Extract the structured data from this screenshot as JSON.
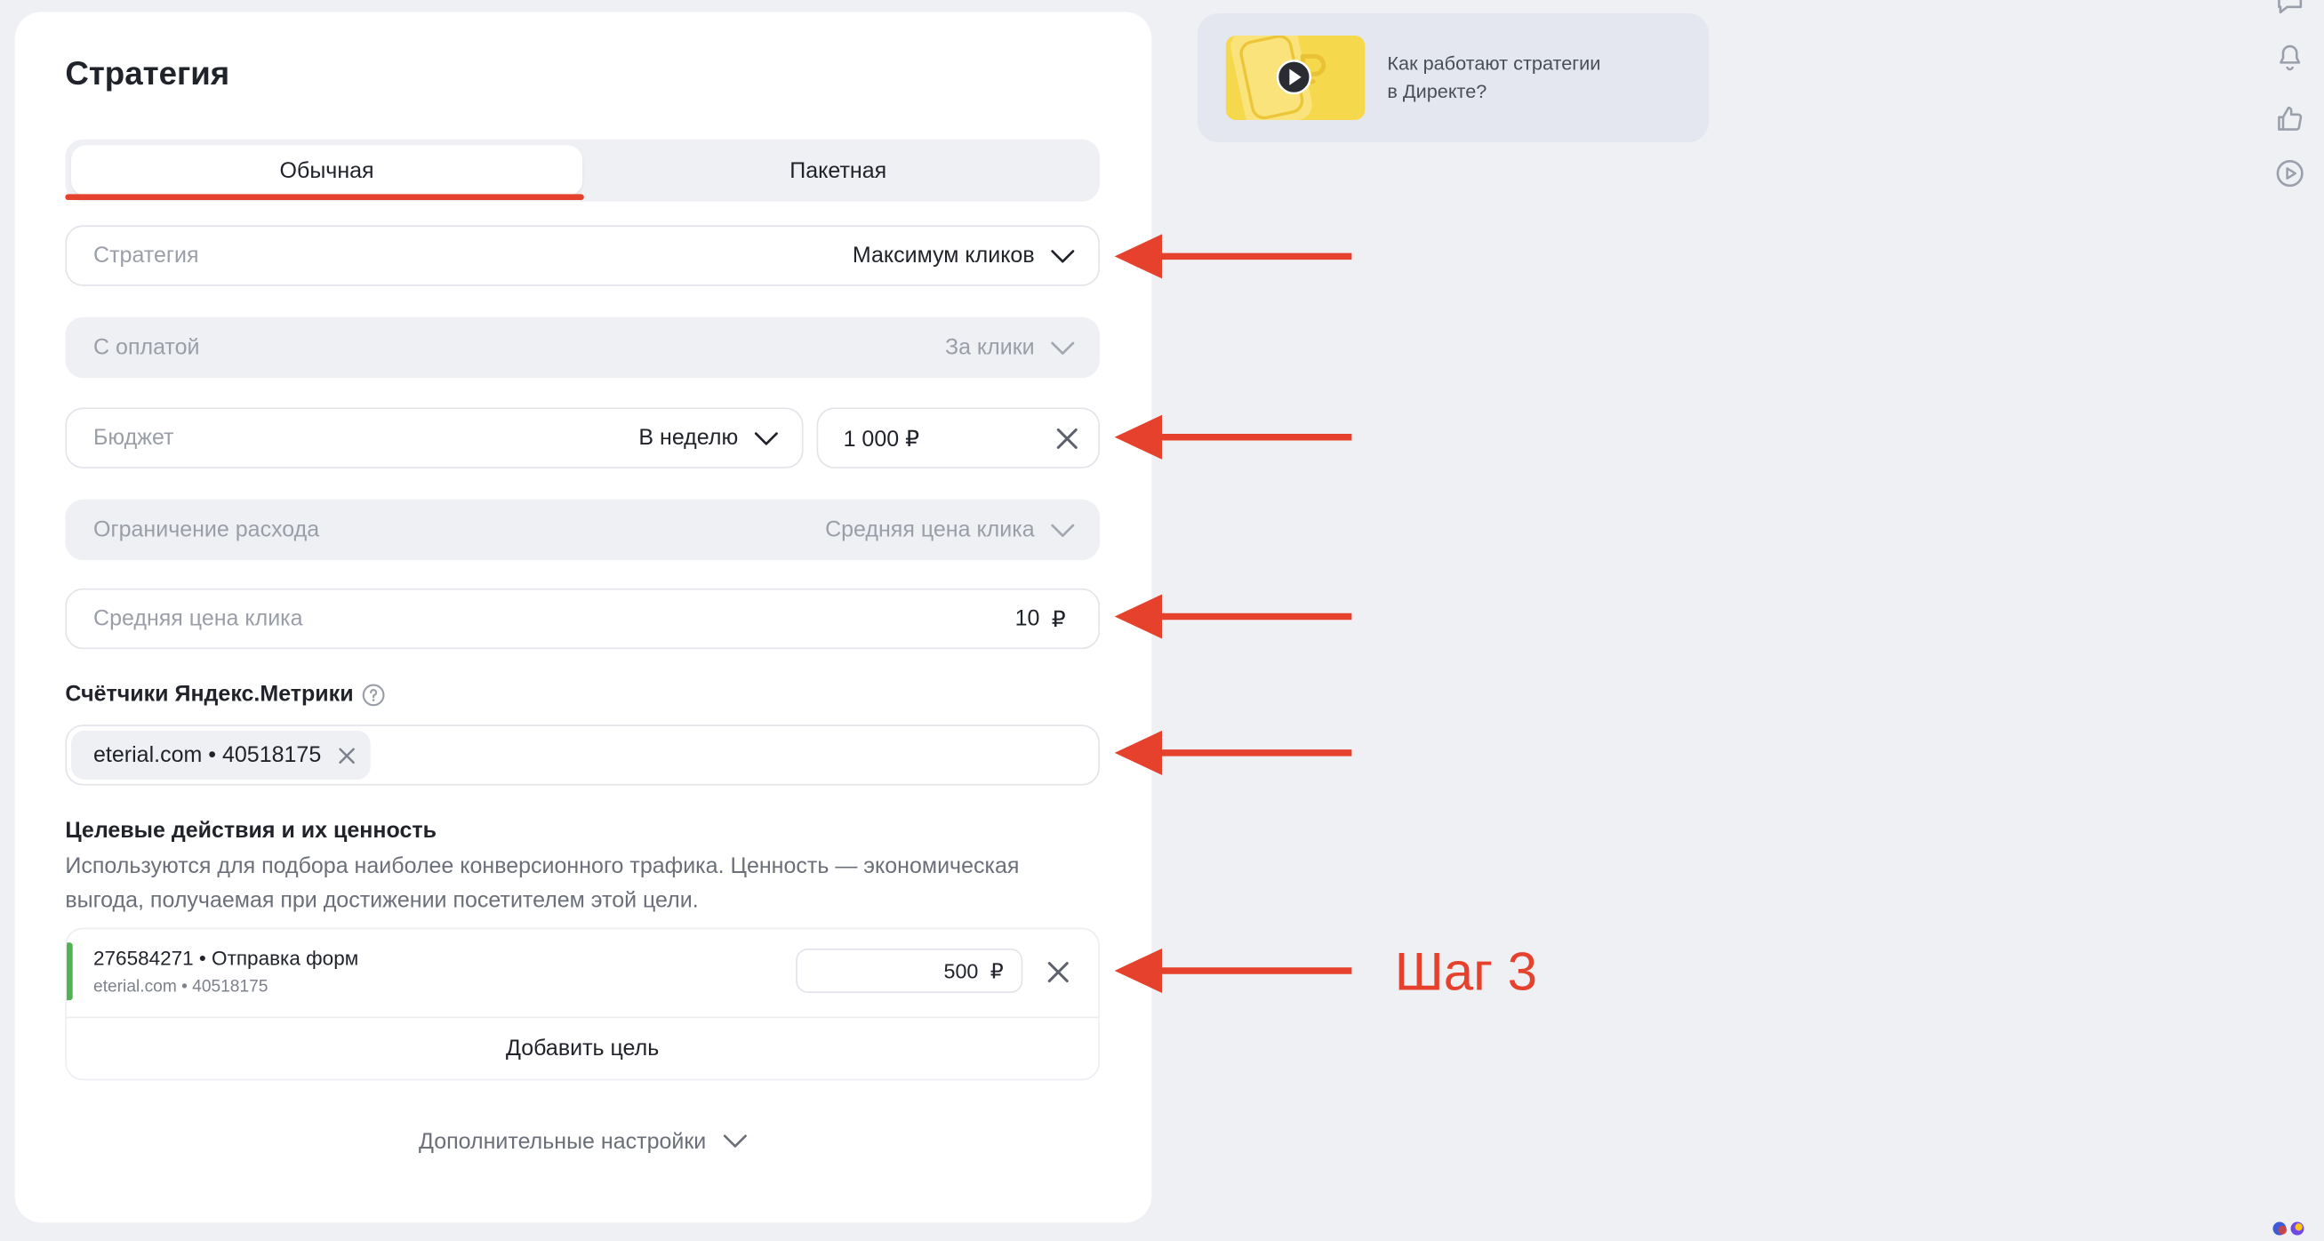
{
  "page": {
    "title": "Стратегия"
  },
  "tabs": [
    {
      "label": "Обычная",
      "active": true
    },
    {
      "label": "Пакетная",
      "active": false
    }
  ],
  "fields": {
    "strategy": {
      "label": "Стратегия",
      "value": "Максимум кликов"
    },
    "payment": {
      "label": "С оплатой",
      "value": "За клики"
    },
    "budget": {
      "label": "Бюджет",
      "period": "В неделю",
      "amount": "1 000 ₽"
    },
    "spend_limit": {
      "label": "Ограничение расхода",
      "value": "Средняя цена клика"
    },
    "avg_cpc": {
      "label": "Средняя цена клика",
      "value": "10",
      "currency": "₽"
    }
  },
  "metrika": {
    "label": "Счётчики Яндекс.Метрики",
    "chip": "eterial.com • 40518175"
  },
  "goals": {
    "title": "Целевые действия и их ценность",
    "description": [
      "Используются для подбора наиболее конверсионного трафика. Ценность — экономическая",
      "выгода, получаемая при достижении посетителем этой цели."
    ],
    "items": [
      {
        "name": "276584271 • Отправка форм",
        "counter": "eterial.com • 40518175",
        "value": "500",
        "currency": "₽"
      }
    ],
    "add_label": "Добавить цель"
  },
  "advanced": {
    "label": "Дополнительные настройки"
  },
  "help_card": {
    "line1": "Как работают стратегии",
    "line2": "в Директе?"
  },
  "annotations": {
    "step_label": "Шаг 3"
  },
  "side_icons": [
    "chat-icon",
    "bell-icon",
    "thumbs-up-icon",
    "play-circle-icon"
  ],
  "colors": {
    "accent_red": "#e5412d",
    "goal_bar_green": "#52b153",
    "page_bg": "#eff0f4",
    "card_bg": "#ffffff",
    "help_card_bg": "#e4e7ef",
    "thumbnail_yellow": "#f5d84b"
  }
}
